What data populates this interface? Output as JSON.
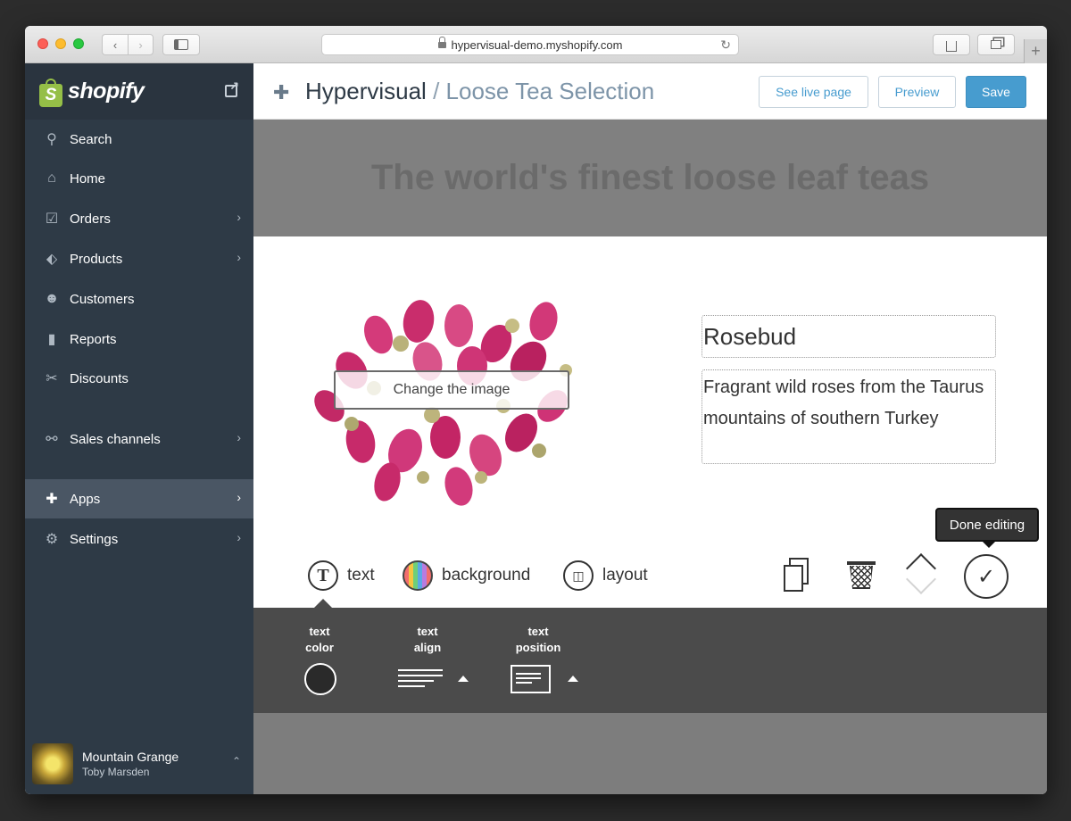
{
  "browser": {
    "url": "hypervisual-demo.myshopify.com",
    "nav_back": "‹",
    "nav_forward": "›",
    "reload": "↻",
    "new_tab": "+"
  },
  "sidebar": {
    "brand": "shopify",
    "brand_mark": "S",
    "items": [
      {
        "label": "Search",
        "icon": "search-icon",
        "glyph": "⚲"
      },
      {
        "label": "Home",
        "icon": "home-icon",
        "glyph": "⌂"
      },
      {
        "label": "Orders",
        "icon": "orders-icon",
        "glyph": "☑"
      },
      {
        "label": "Products",
        "icon": "tag-icon",
        "glyph": "⬖"
      },
      {
        "label": "Customers",
        "icon": "customers-icon",
        "glyph": "☻"
      },
      {
        "label": "Reports",
        "icon": "bar-chart-icon",
        "glyph": "▮"
      },
      {
        "label": "Discounts",
        "icon": "discount-icon",
        "glyph": "✂"
      },
      {
        "label": "Sales channels",
        "icon": "channels-icon",
        "glyph": "⚯"
      },
      {
        "label": "Apps",
        "icon": "puzzle-icon",
        "glyph": "✚"
      },
      {
        "label": "Settings",
        "icon": "gear-icon",
        "glyph": "⚙"
      }
    ],
    "chevron": "›",
    "account": {
      "store": "Mountain Grange",
      "user": "Toby Marsden",
      "chevron": "⌃"
    }
  },
  "topbar": {
    "app": "Hypervisual",
    "separator": "/",
    "page": "Loose Tea Selection",
    "see_live": "See live page",
    "preview": "Preview",
    "save": "Save"
  },
  "hero": {
    "title": "The world's finest loose leaf teas"
  },
  "card": {
    "change_image": "Change the image",
    "product_title": "Rosebud",
    "product_desc": "Fragrant wild roses from the Taurus mountains of southern Turkey",
    "tooltip": "Done editing",
    "done_glyph": "✓"
  },
  "toolbar": {
    "text": {
      "label": "text",
      "glyph": "T"
    },
    "background": {
      "label": "background"
    },
    "layout": {
      "label": "layout",
      "glyph": "◫"
    }
  },
  "subpanel": {
    "text_color": [
      "text",
      "color"
    ],
    "text_align": [
      "text",
      "align"
    ],
    "text_position": [
      "text",
      "position"
    ]
  },
  "colors": {
    "sidebar": "#2e3a46",
    "accent": "#479ccf",
    "brand_green": "#95bf47",
    "rose": "#c72a6a"
  }
}
